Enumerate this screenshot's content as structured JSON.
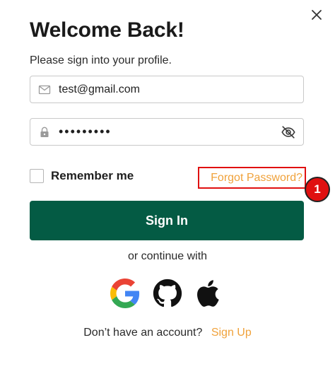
{
  "header": {
    "title": "Welcome Back!",
    "subtitle": "Please sign into your profile."
  },
  "form": {
    "email": {
      "value": "test@gmail.com",
      "icon": "mail-icon"
    },
    "password": {
      "value": "•••••••••",
      "icon": "lock-icon",
      "toggle_icon": "eye-off-icon"
    },
    "remember_label": "Remember me",
    "forgot_label": "Forgot Password?",
    "signin_label": "Sign In"
  },
  "annotation": {
    "badge": "1"
  },
  "social": {
    "continue_label": "or continue with",
    "providers": [
      "google-icon",
      "github-icon",
      "apple-icon"
    ]
  },
  "footer": {
    "prompt": "Don’t have an account?",
    "signup_label": "Sign Up"
  },
  "colors": {
    "primary": "#045b44",
    "accent": "#f0a23b",
    "highlight": "#e01010"
  }
}
